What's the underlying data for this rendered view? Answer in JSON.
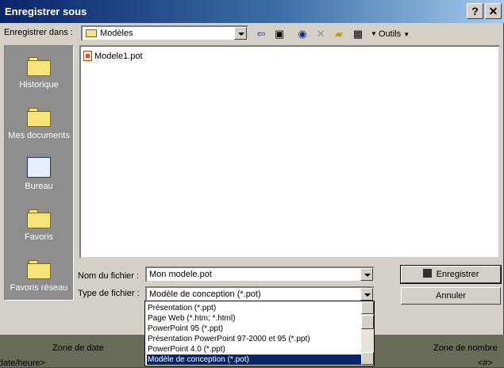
{
  "window": {
    "title": "Enregistrer sous",
    "help_glyph": "?",
    "close_glyph": "✕"
  },
  "location": {
    "label": "Enregistrer dans :",
    "value": "Modèles"
  },
  "toolbar": {
    "back_icon": "arrow-left-icon",
    "up_icon": "folder-up-icon",
    "search_web_icon": "search-web-icon",
    "delete_icon": "delete-icon",
    "new_folder_icon": "new-folder-icon",
    "views_icon": "views-icon",
    "tools_label": "Outils"
  },
  "places": [
    {
      "label": "Historique",
      "icon": "history-icon"
    },
    {
      "label": "Mes documents",
      "icon": "my-documents-icon"
    },
    {
      "label": "Bureau",
      "icon": "desktop-icon"
    },
    {
      "label": "Favoris",
      "icon": "favorites-icon"
    },
    {
      "label": "Favoris réseau",
      "icon": "network-favorites-icon"
    }
  ],
  "files": [
    {
      "name": "Modele1.pot",
      "icon": "pot-file-icon"
    }
  ],
  "filename": {
    "label": "Nom du fichier :",
    "value": "Mon modele.pot"
  },
  "filetype": {
    "label": "Type de fichier :",
    "value": "Modèle de conception (*.pot)",
    "options": [
      "Présentation (*.ppt)",
      "Page Web (*.htm; *.html)",
      "PowerPoint 95 (*.ppt)",
      "Présentation PowerPoint 97-2000 et 95 (*.ppt)",
      "PowerPoint 4.0 (*.ppt)",
      "Modèle de conception (*.pot)"
    ],
    "selected_index": 5
  },
  "buttons": {
    "save": "Enregistrer",
    "cancel": "Annuler"
  },
  "background": {
    "left_label": "Zone de date",
    "left_sub": "date/heure>",
    "right_label": "Zone de nombre",
    "right_sub": "<#>"
  }
}
